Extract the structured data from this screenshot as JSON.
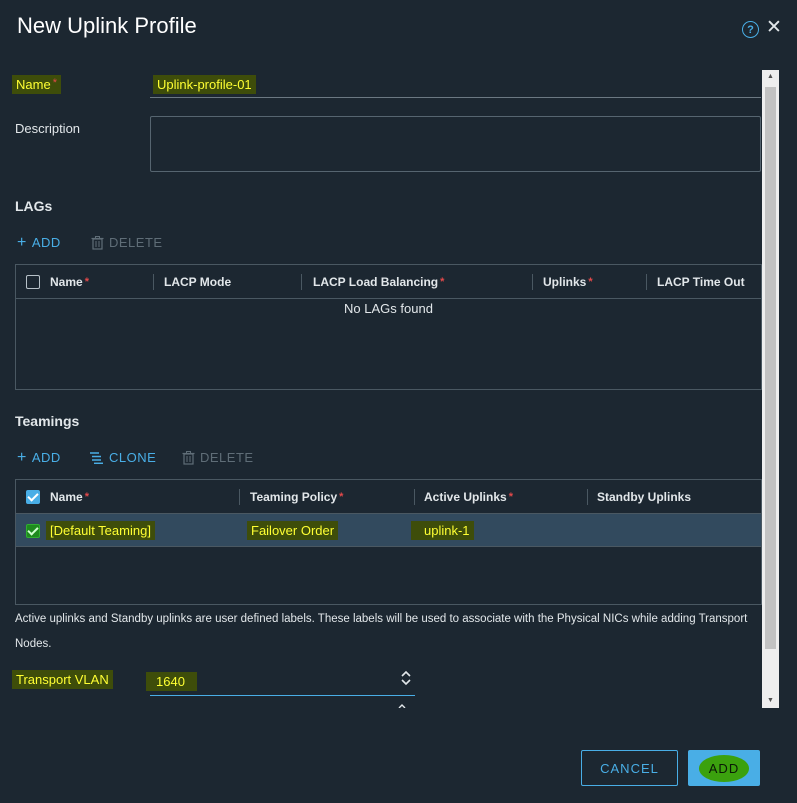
{
  "dialog": {
    "title": "New Uplink Profile",
    "help_icon": "?",
    "close_icon": "✕"
  },
  "form": {
    "name_label": "Name",
    "required_mark": "*",
    "name_value": "Uplink-profile-01",
    "description_label": "Description",
    "description_value": ""
  },
  "lags": {
    "section_title": "LAGs",
    "add_label": "ADD",
    "delete_label": "DELETE",
    "columns": [
      "Name",
      "LACP Mode",
      "LACP Load Balancing",
      "Uplinks",
      "LACP Time Out"
    ],
    "empty_message": "No LAGs found"
  },
  "teamings": {
    "section_title": "Teamings",
    "add_label": "ADD",
    "clone_label": "CLONE",
    "delete_label": "DELETE",
    "columns": [
      "Name",
      "Teaming Policy",
      "Active Uplinks",
      "Standby Uplinks"
    ],
    "rows": [
      {
        "name": "[Default Teaming]",
        "policy": "Failover Order",
        "active": "uplink-1",
        "standby": ""
      }
    ],
    "hint": "Active uplinks and Standby uplinks are user defined labels. These labels will be used to associate with the Physical NICs while adding Transport Nodes."
  },
  "transport_vlan": {
    "label": "Transport VLAN",
    "value": "1640"
  },
  "footer": {
    "cancel_label": "CANCEL",
    "add_label": "ADD"
  },
  "colors": {
    "background": "#1c2731",
    "accent": "#49aee6",
    "required": "#e2494a",
    "selected_row": "#324a5e"
  },
  "icons": {
    "plus": "plus-icon",
    "trash": "trash-icon",
    "clone": "clone-icon",
    "spinner": "spinner-arrows-icon"
  }
}
